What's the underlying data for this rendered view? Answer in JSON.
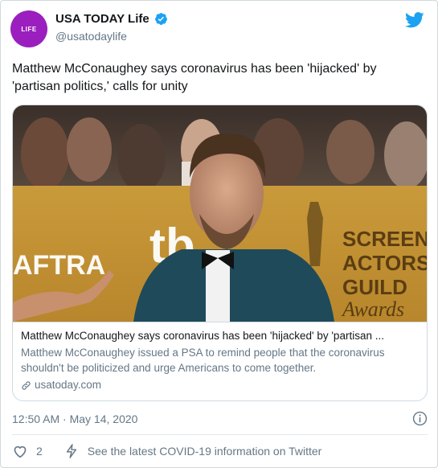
{
  "account": {
    "avatar_text": "LIFE",
    "display_name": "USA TODAY Life",
    "handle": "@usatodaylife",
    "verified": true
  },
  "tweet": {
    "text": "Matthew McConaughey says coronavirus has been 'hijacked' by 'partisan politics,' calls for unity"
  },
  "card": {
    "image_icon": "photo-of-man-in-tuxedo",
    "title": "Matthew McConaughey says coronavirus has been 'hijacked' by 'partisan ...",
    "description": "Matthew McConaughey issued a PSA to remind people that the coronavirus shouldn't be politicized and urge Americans to come together.",
    "domain": "usatoday.com"
  },
  "meta": {
    "timestamp": "12:50 AM · May 14, 2020"
  },
  "actions": {
    "like_count": "2",
    "covid_link": "See the latest COVID-19 information on Twitter"
  },
  "colors": {
    "avatar_bg": "#9b1fbf",
    "twitter_blue": "#1da1f2",
    "secondary_text": "#657786"
  }
}
